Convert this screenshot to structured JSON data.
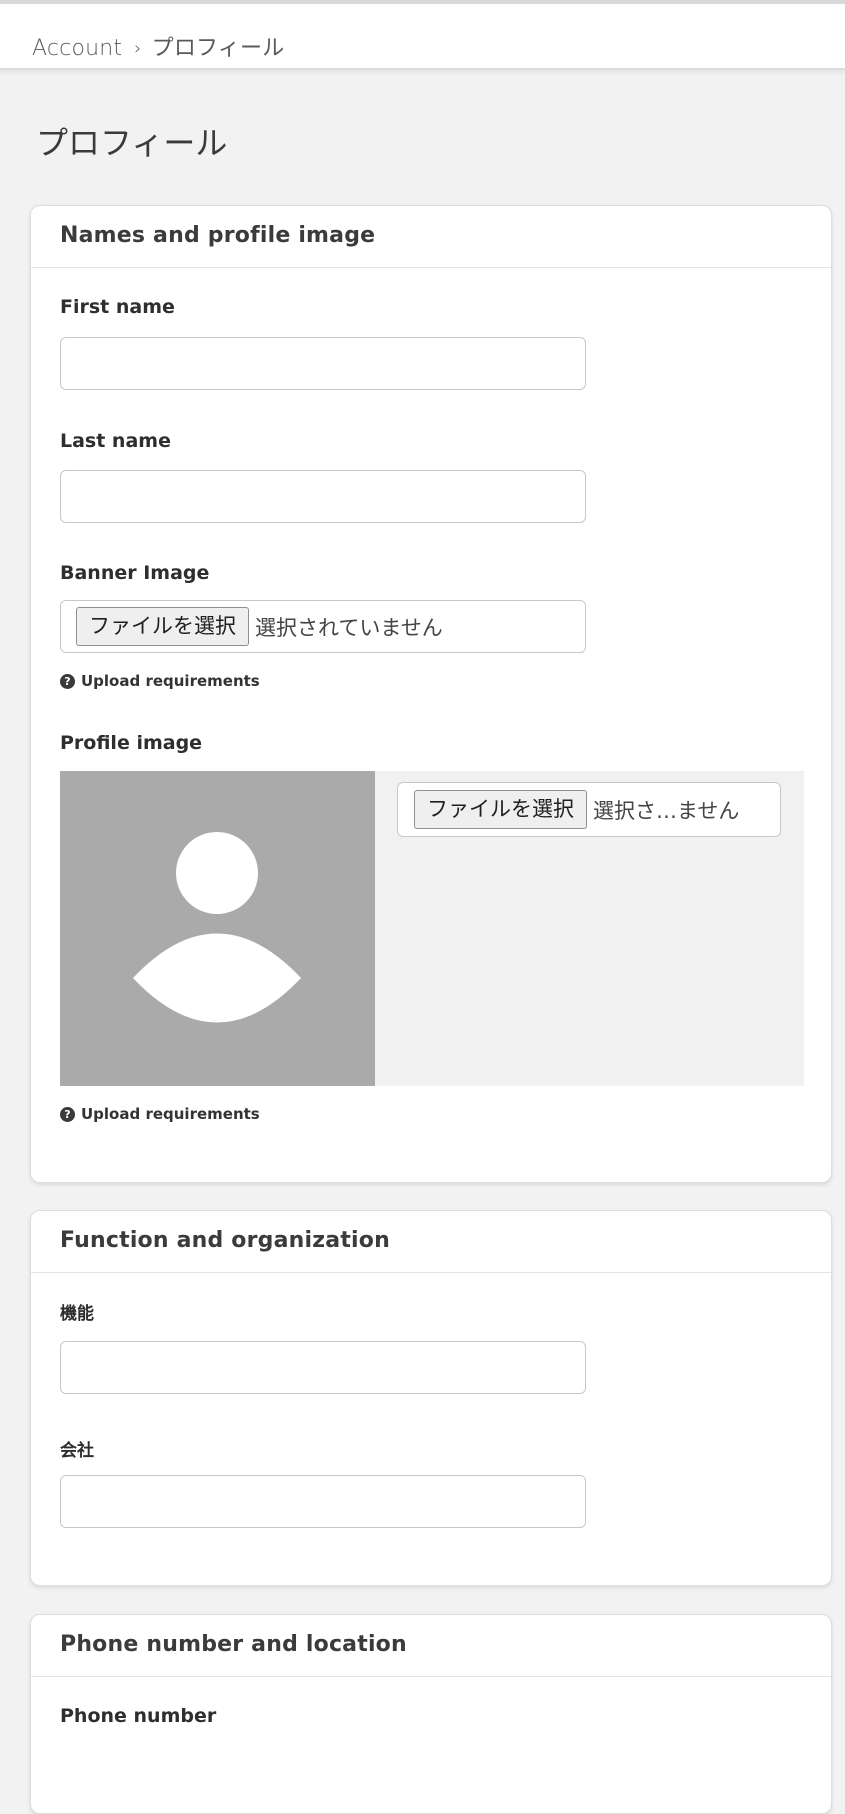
{
  "breadcrumb": {
    "root": "Account",
    "separator": "›",
    "current": "プロフィール"
  },
  "page": {
    "title": "プロフィール"
  },
  "names_card": {
    "title": "Names and profile image",
    "first_name": {
      "label": "First name",
      "value": ""
    },
    "last_name": {
      "label": "Last name",
      "value": ""
    },
    "banner_image": {
      "label": "Banner Image",
      "button": "ファイルを選択",
      "status": "選択されていません",
      "help": "Upload requirements"
    },
    "profile_image": {
      "label": "Profile image",
      "button": "ファイルを選択",
      "status": "選択さ…ません",
      "help": "Upload requirements"
    }
  },
  "function_card": {
    "title": "Function and organization",
    "function": {
      "label": "機能",
      "value": ""
    },
    "company": {
      "label": "会社",
      "value": ""
    }
  },
  "phone_card": {
    "title": "Phone number and location",
    "phone": {
      "label": "Phone number"
    }
  },
  "icons": {
    "help": "question-circle-icon",
    "avatar": "user-silhouette-icon"
  },
  "colors": {
    "page_bg": "#f2f2f2",
    "card_bg": "#ffffff",
    "avatar_bg": "#aaaaaa"
  }
}
